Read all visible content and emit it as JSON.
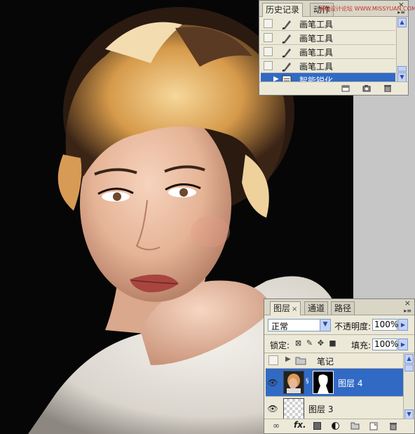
{
  "canvas": {
    "description_icon": "portrait-photo"
  },
  "watermark": {
    "text": "思缘设计论坛  WWW.MISSYUAN.COM"
  },
  "history_panel": {
    "tabs": [
      {
        "label": "历史记录"
      },
      {
        "label": "动作"
      }
    ],
    "close_glyph": "×",
    "menu_glyph": "▸≡",
    "items": [
      {
        "label": "画笔工具",
        "icon": "brush-icon",
        "selected": false
      },
      {
        "label": "画笔工具",
        "icon": "brush-icon",
        "selected": false
      },
      {
        "label": "画笔工具",
        "icon": "brush-icon",
        "selected": false
      },
      {
        "label": "画笔工具",
        "icon": "brush-icon",
        "selected": false
      },
      {
        "label": "智能锐化",
        "icon": "filter-icon",
        "selected": true
      }
    ],
    "footer_icons": [
      "new-document-icon",
      "snapshot-camera-icon",
      "trash-icon"
    ]
  },
  "layers_panel": {
    "tabs": [
      {
        "label": "图层",
        "close": "×"
      },
      {
        "label": "通道"
      },
      {
        "label": "路径"
      }
    ],
    "blend_mode": "正常",
    "opacity_label": "不透明度:",
    "opacity_value": "100%",
    "lock_label": "锁定:",
    "fill_label": "填充:",
    "fill_value": "100%",
    "layers": [
      {
        "name": "笔记",
        "type": "group",
        "visible": false,
        "selected": false
      },
      {
        "name": "图层 4",
        "type": "layer-with-mask",
        "visible": true,
        "selected": true
      },
      {
        "name": "图层 3",
        "type": "transparent-layer",
        "visible": true,
        "selected": false
      }
    ],
    "footer_icons": [
      "link-icon",
      "fx-icon",
      "mask-icon",
      "adjustment-icon",
      "folder-icon",
      "new-layer-icon",
      "trash-icon"
    ],
    "footer_fx": "fx."
  },
  "colors": {
    "selection": "#316ac5",
    "panel_bg": "#ece9d8",
    "canvas_bg": "#060606"
  }
}
